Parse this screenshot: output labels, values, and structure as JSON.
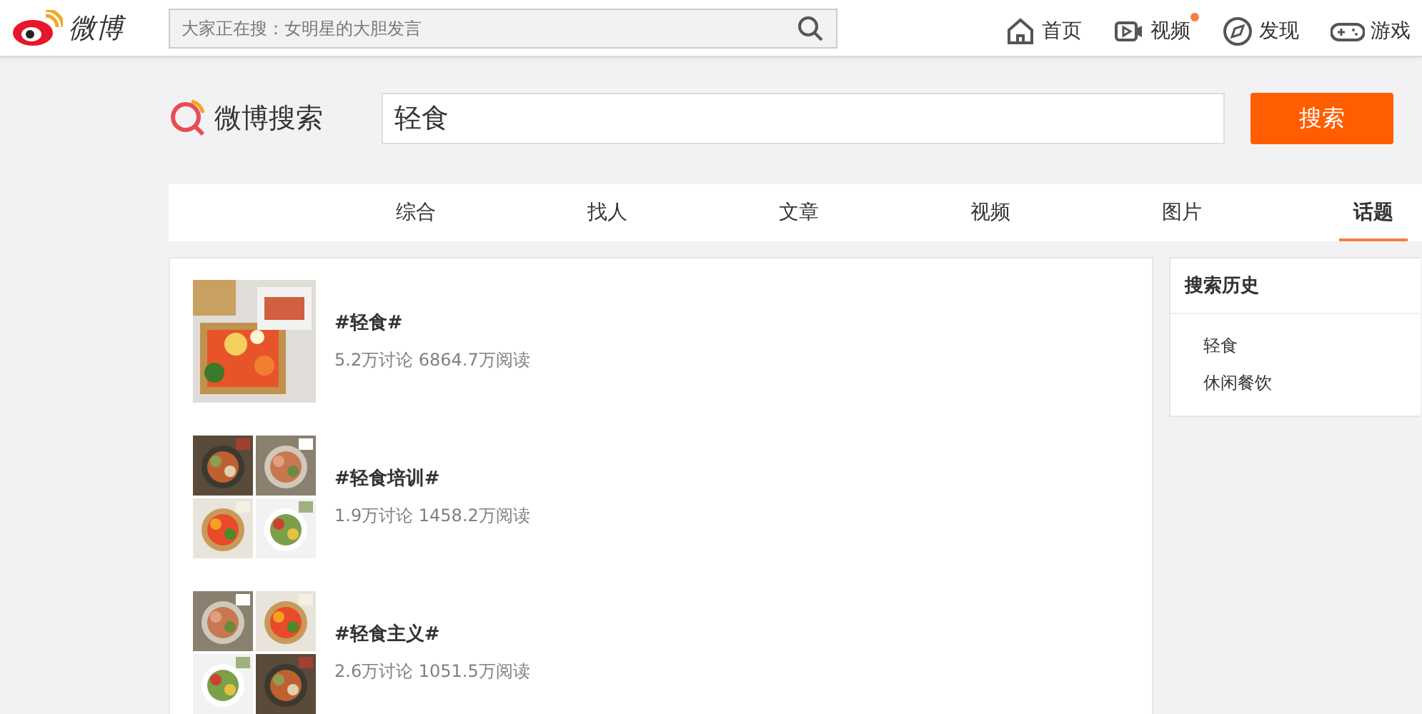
{
  "header": {
    "logo": "微博",
    "search": {
      "placeholder": "大家正在搜：女明星的大胆发言"
    },
    "nav": [
      {
        "label": "首页",
        "kind": "home",
        "new": false
      },
      {
        "label": "视频",
        "kind": "video",
        "new": true
      },
      {
        "label": "发现",
        "kind": "compass",
        "new": false
      },
      {
        "label": "游戏",
        "kind": "game",
        "new": false
      }
    ]
  },
  "search_bar": {
    "logo": "微博搜索",
    "query": "轻食",
    "button": "搜索"
  },
  "tabs": [
    {
      "label": "综合",
      "selected": false
    },
    {
      "label": "找人",
      "selected": false
    },
    {
      "label": "文章",
      "selected": false
    },
    {
      "label": "视频",
      "selected": false
    },
    {
      "label": "图片",
      "selected": false
    },
    {
      "label": "话题",
      "selected": true
    }
  ],
  "topics": [
    {
      "kind": "single",
      "title": "#轻食#",
      "stats": "5.2万讨论 6864.7万阅读"
    },
    {
      "kind": "grid",
      "title": "#轻食培训#",
      "stats": "1.9万讨论 1458.2万阅读"
    },
    {
      "kind": "grid",
      "title": "#轻食主义#",
      "stats": "2.6万讨论 1051.5万阅读"
    }
  ],
  "history": {
    "title": "搜索历史",
    "items": [
      "轻食",
      "休闲餐饮"
    ]
  }
}
